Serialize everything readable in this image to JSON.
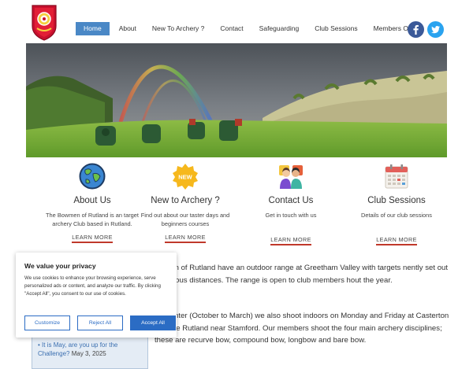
{
  "nav": {
    "items": [
      {
        "label": "Home",
        "active": true
      },
      {
        "label": "About"
      },
      {
        "label": "New To Archery ?"
      },
      {
        "label": "Contact"
      },
      {
        "label": "Safeguarding"
      },
      {
        "label": "Club Sessions"
      },
      {
        "label": "Members Only"
      }
    ]
  },
  "social": {
    "facebook_icon": "facebook-icon",
    "twitter_icon": "twitter-icon"
  },
  "features": [
    {
      "icon": "globe-icon",
      "title": "About Us",
      "desc": "The Bowmen of Rutland is an target archery Club based in Rutland.",
      "more": "LEARN MORE"
    },
    {
      "icon": "new-badge-icon",
      "badge": "NEW",
      "title": "New to Archery ?",
      "desc": "Find out about our taster days and beginners courses",
      "more": "LEARN MORE"
    },
    {
      "icon": "people-icon",
      "title": "Contact Us",
      "desc": "Get in touch with us",
      "more": "LEARN MORE"
    },
    {
      "icon": "calendar-icon",
      "title": "Club Sessions",
      "desc": "Details of our club sessions",
      "more": "LEARN MORE"
    }
  ],
  "main": {
    "p1": "owmen of Rutland have an outdoor range at Greetham Valley with targets nently set out at various distances. The range is open to club members hout the year.",
    "p2": " the winter (October to March) we also shoot indoors on Monday and Friday at Casterton College Rutland near Stamford. Our members shoot the four main archery disciplines; these are recurve bow, compound bow, longbow and bare bow."
  },
  "sidebar": {
    "link": "It is May, are you up for the Challenge?",
    "date": "May 3, 2025"
  },
  "cookie": {
    "title": "We value your privacy",
    "text": "We use cookies to enhance your browsing experience, serve personalized ads or content, and analyze our traffic. By clicking \"Accept All\", you consent to our use of cookies.",
    "customize": "Customize",
    "reject": "Reject All",
    "accept": "Accept All"
  },
  "colors": {
    "accent": "#4a88c6",
    "button_blue": "#2b6cc4",
    "underline_red": "#c0392b"
  }
}
